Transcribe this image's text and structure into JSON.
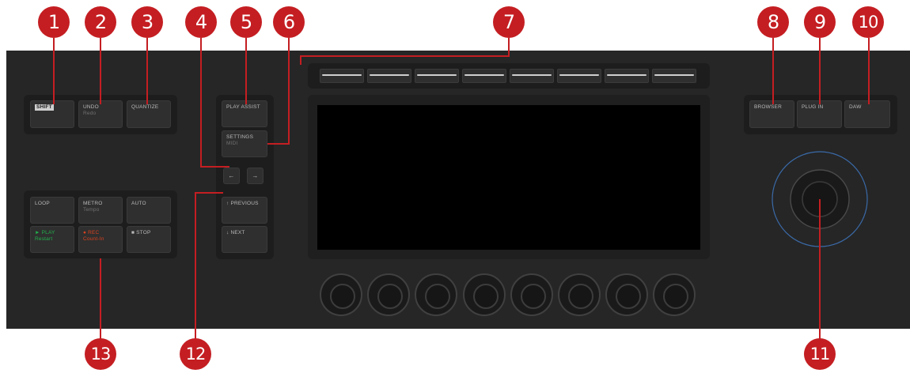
{
  "callouts": [
    "1",
    "2",
    "3",
    "4",
    "5",
    "6",
    "7",
    "8",
    "9",
    "10",
    "11",
    "12",
    "13"
  ],
  "buttons": {
    "shift": {
      "main": "SHIFT"
    },
    "undo": {
      "main": "UNDO",
      "sub": "Redo"
    },
    "quantize": {
      "main": "QUANTIZE"
    },
    "play_assist": {
      "main": "PLAY ASSIST"
    },
    "settings": {
      "main": "SETTINGS",
      "sub": "MIDI"
    },
    "arrow_left": {
      "main": "←"
    },
    "arrow_right": {
      "main": "→"
    },
    "previous": {
      "main": "↑ PREVIOUS"
    },
    "next": {
      "main": "↓ NEXT"
    },
    "browser": {
      "main": "BROWSER"
    },
    "plugin": {
      "main": "PLUG IN"
    },
    "daw": {
      "main": "DAW"
    },
    "loop": {
      "main": "LOOP"
    },
    "metro": {
      "main": "METRO",
      "sub": "Tempo"
    },
    "auto": {
      "main": "AUTO"
    },
    "play": {
      "main": "► PLAY",
      "sub": "Restart"
    },
    "rec": {
      "main": "● REC",
      "sub": "Count-In"
    },
    "stop": {
      "main": "■ STOP"
    }
  },
  "colors": {
    "callout": "#c41e22",
    "device": "#262626",
    "play": "#22b14c",
    "rec": "#d9421f",
    "encoder_ring": "#3a6aa8"
  }
}
